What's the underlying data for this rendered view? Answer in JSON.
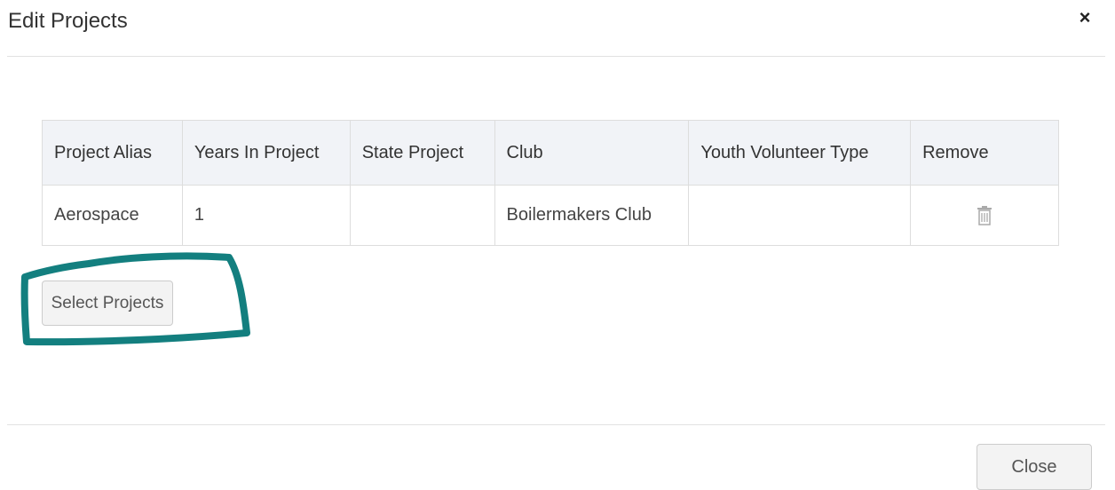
{
  "modal": {
    "title": "Edit Projects",
    "close_glyph": "×"
  },
  "table": {
    "headers": [
      "Project Alias",
      "Years In Project",
      "State Project",
      "Club",
      "Youth Volunteer Type",
      "Remove"
    ],
    "rows": [
      {
        "project_alias": "Aerospace",
        "years_in_project": "1",
        "state_project": "",
        "club": "Boilermakers Club",
        "youth_volunteer_type": "",
        "remove_icon": "trash-icon"
      }
    ]
  },
  "buttons": {
    "select_projects": "Select Projects",
    "close": "Close"
  },
  "colors": {
    "annotation_stroke": "#137f7f",
    "header_background": "#f1f3f7"
  }
}
